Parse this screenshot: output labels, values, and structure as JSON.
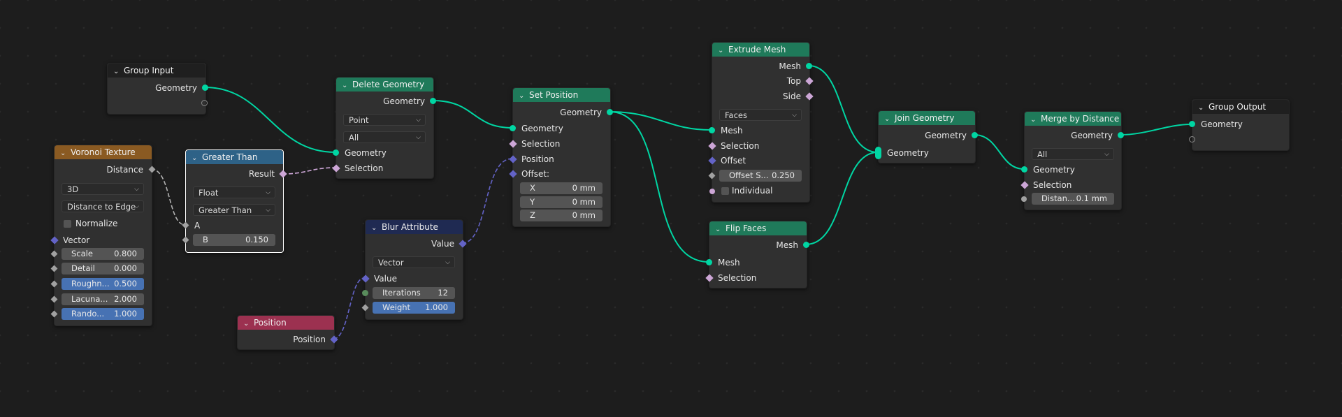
{
  "colors": {
    "background": "#1d1d1d",
    "link": "#00d6a3",
    "geometry_socket": "#00d6a3",
    "vector_socket": "#6363c7",
    "boolean_socket": "#cca6d6",
    "float_socket": "#a1a1a1",
    "selected_field": "#4772b3"
  },
  "nodes": {
    "group_input": {
      "title": "Group Input",
      "out_geometry": "Geometry"
    },
    "voronoi": {
      "title": "Voronoi Texture",
      "out_distance": "Distance",
      "dim": "3D",
      "feature": "Distance to Edge",
      "normalize": "Normalize",
      "vector": "Vector",
      "scale_l": "Scale",
      "scale_v": "0.800",
      "detail_l": "Detail",
      "detail_v": "0.000",
      "rough_l": "Roughn...",
      "rough_v": "0.500",
      "lac_l": "Lacuna...",
      "lac_v": "2.000",
      "rand_l": "Rando...",
      "rand_v": "1.000"
    },
    "greater_than": {
      "title": "Greater Than",
      "out_result": "Result",
      "type": "Float",
      "op": "Greater Than",
      "a": "A",
      "b_l": "B",
      "b_v": "0.150"
    },
    "position": {
      "title": "Position",
      "out": "Position"
    },
    "delete_geometry": {
      "title": "Delete Geometry",
      "out_geometry": "Geometry",
      "domain": "Point",
      "mode": "All",
      "in_geometry": "Geometry",
      "in_selection": "Selection"
    },
    "blur_attribute": {
      "title": "Blur Attribute",
      "out_value": "Value",
      "type": "Vector",
      "in_value": "Value",
      "iter_l": "Iterations",
      "iter_v": "12",
      "weight_l": "Weight",
      "weight_v": "1.000"
    },
    "set_position": {
      "title": "Set Position",
      "out_geometry": "Geometry",
      "in_geometry": "Geometry",
      "in_selection": "Selection",
      "in_position": "Position",
      "in_offset": "Offset:",
      "x_l": "X",
      "x_v": "0 mm",
      "y_l": "Y",
      "y_v": "0 mm",
      "z_l": "Z",
      "z_v": "0 mm"
    },
    "extrude_mesh": {
      "title": "Extrude Mesh",
      "out_mesh": "Mesh",
      "out_top": "Top",
      "out_side": "Side",
      "mode": "Faces",
      "in_mesh": "Mesh",
      "in_selection": "Selection",
      "in_offset": "Offset",
      "scale_l": "Offset S...",
      "scale_v": "0.250",
      "individual": "Individual"
    },
    "flip_faces": {
      "title": "Flip Faces",
      "out_mesh": "Mesh",
      "in_mesh": "Mesh",
      "in_selection": "Selection"
    },
    "join_geometry": {
      "title": "Join Geometry",
      "out_geometry": "Geometry",
      "in_geometry": "Geometry"
    },
    "merge_distance": {
      "title": "Merge by Distance",
      "out_geometry": "Geometry",
      "mode": "All",
      "in_geometry": "Geometry",
      "in_selection": "Selection",
      "dist_l": "Distan...",
      "dist_v": "0.1 mm"
    },
    "group_output": {
      "title": "Group Output",
      "in_geometry": "Geometry"
    }
  }
}
